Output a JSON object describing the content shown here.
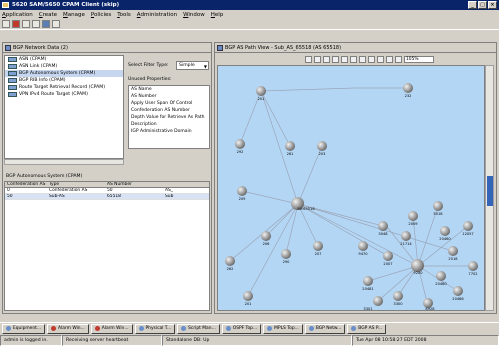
{
  "window": {
    "title": "5620 SAM/5650 CPAM Client (skip)"
  },
  "menu": [
    "Application",
    "Create",
    "Manage",
    "Policies",
    "Tools",
    "Administration",
    "Window",
    "Help"
  ],
  "left_panel": {
    "title": "BGP Network Data (2)",
    "tree_items": [
      "ASN (CPAM)",
      "ASN Link (CPAM)",
      "BGP Autonomous System (CPAM)",
      "BGP RIB Info (CPAM)",
      "Route Target Retrieval Record (CPAM)",
      "VPN IPv4 Route Target (CPAM)"
    ],
    "filter_label": "Select Filter Type:",
    "filter_value": "Simple",
    "unused_label": "Unused Properties:",
    "properties": [
      "AS Name",
      "AS Number",
      "Apply User Span Of Control",
      "Confederation AS Number",
      "Depth Value for Retrieve As Path",
      "Description",
      "IGP Administrative Domain"
    ],
    "grid_title": "BGP Autonomous System (CPAM)",
    "grid_headers": [
      "Confederation AS",
      "Type",
      "AS Number",
      ""
    ],
    "grid_rows": [
      [
        "0",
        "Confederation AS",
        "50",
        "AS_"
      ],
      [
        "50",
        "Sub-AS",
        "65518",
        "Sub"
      ]
    ]
  },
  "graph_panel": {
    "title": "BGP AS Path View - Sub_AS_65518 (AS 65518)",
    "zoom": "105%",
    "hub_label": "50:65518",
    "nodes": [
      "201",
      "232",
      "292",
      "261",
      "203",
      "209",
      "206",
      "290",
      "207",
      "262",
      "201",
      "3048",
      "2009",
      "5018",
      "12057",
      "2007",
      "2518",
      "7702",
      "9200",
      "20481",
      "20486",
      "3300",
      "3301",
      "8928",
      "9470",
      "21714",
      "20460",
      "20480"
    ]
  },
  "taskbar": [
    "Equipment...",
    "Alarm Win...",
    "Alarm Win...",
    "Physical T...",
    "Script Man...",
    "OSPF Top...",
    "MPLS Top...",
    "BGP Netw...",
    "BGP AS P..."
  ],
  "status": {
    "user": "admin is logged in.",
    "heartbeat": "Receiving server heartbeat",
    "db": "Standalone DB: Up",
    "datetime": "Tue Apr 08 10:58:27 EDT 2008"
  }
}
